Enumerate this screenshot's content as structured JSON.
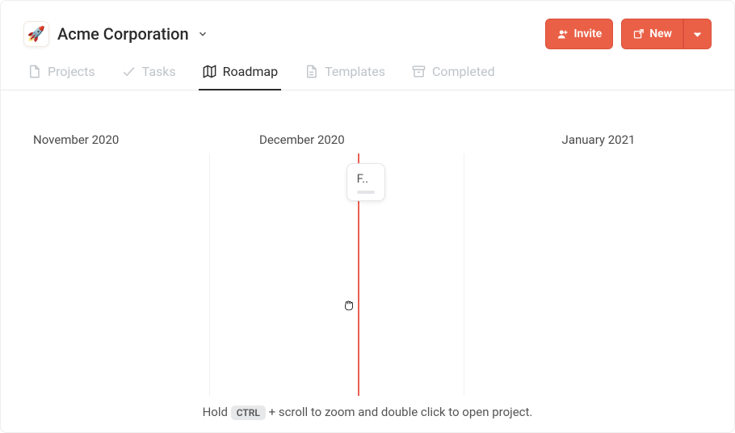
{
  "workspace": {
    "name": "Acme Corporation",
    "logo_emoji": "🚀"
  },
  "actions": {
    "invite_label": "Invite",
    "new_label": "New"
  },
  "tabs": [
    {
      "id": "projects",
      "label": "Projects"
    },
    {
      "id": "tasks",
      "label": "Tasks"
    },
    {
      "id": "roadmap",
      "label": "Roadmap"
    },
    {
      "id": "templates",
      "label": "Templates"
    },
    {
      "id": "completed",
      "label": "Completed"
    }
  ],
  "active_tab": "roadmap",
  "timeline": {
    "columns": [
      "November 2020",
      "December 2020",
      "January 2021"
    ],
    "today_marker": true,
    "cards": [
      {
        "id": "c1",
        "truncated_label": "F.."
      }
    ]
  },
  "hint": {
    "pre": "Hold ",
    "key": "CTRL",
    "post": " + scroll to zoom and double click to open project."
  }
}
